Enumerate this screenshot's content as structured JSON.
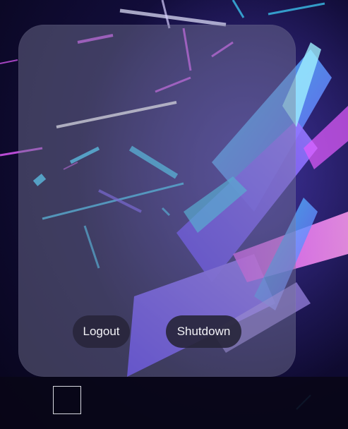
{
  "session": {
    "logout_label": "Logout",
    "shutdown_label": "Shutdown"
  },
  "taskbar": {
    "tiles": [
      {
        "icon": "square-outline-icon"
      }
    ]
  },
  "colors": {
    "background": "#07051a",
    "panel": "#787896",
    "button": "#28263c",
    "button_text": "#f2f2f6",
    "shard_cyan": "#3fd6ff",
    "shard_violet": "#7a5cff",
    "shard_pink": "#e45cff"
  }
}
